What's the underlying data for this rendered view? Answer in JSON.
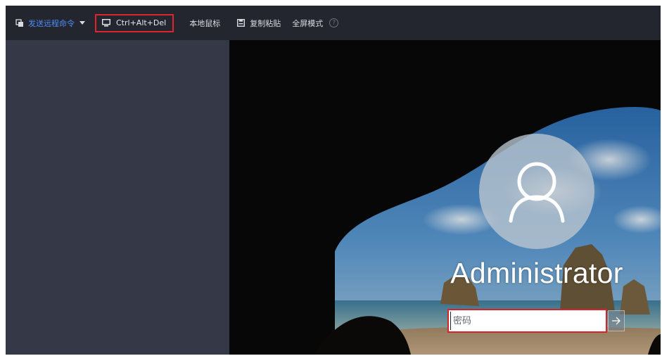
{
  "toolbar": {
    "send_remote_command": "发送远程命令",
    "ctrl_alt_del": "Ctrl+Alt+Del",
    "local_mouse": "本地鼠标",
    "copy_paste": "复制粘贴",
    "fullscreen_mode": "全屏模式",
    "help": "?"
  },
  "login": {
    "username": "Administrator",
    "password_placeholder": "密码"
  },
  "colors": {
    "accent": "#4f8df5",
    "highlight_border": "#e0242b"
  },
  "icons": {
    "send": "command-window-icon",
    "ctrl_alt_del": "monitor-icon",
    "copy_paste": "clipboard-icon",
    "help": "help-circle-icon",
    "submit": "arrow-right-icon",
    "avatar": "user-icon"
  }
}
